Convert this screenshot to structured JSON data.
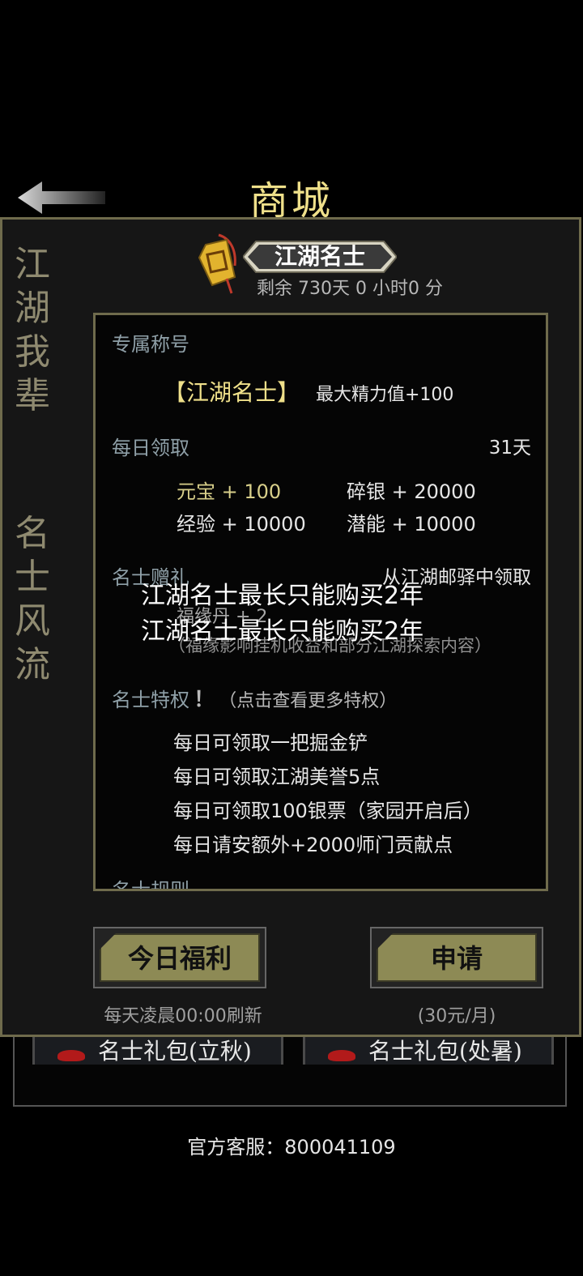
{
  "header": {
    "title": "商城"
  },
  "side_banner": {
    "left_top": [
      "江",
      "湖",
      "我",
      "辈"
    ],
    "left_bottom": [
      "名",
      "士",
      "风",
      "流"
    ]
  },
  "membership": {
    "name": "江湖名士",
    "remaining": "剩余 730天 0 小时0 分"
  },
  "sections": {
    "title_label": "专属称号",
    "title_value": "【江湖名士】",
    "title_bonus": "最大精力值+100",
    "daily_label": "每日领取",
    "daily_days": "31天",
    "daily_items": {
      "yuanbao": "元宝 + 100",
      "suiyin": "碎银 + 20000",
      "jingyan": "经验 + 10000",
      "qianneng": "潜能 + 10000"
    },
    "gift_label": "名士赠礼",
    "gift_source": "从江湖邮驿中领取",
    "gift_item": "福缘丹 + 2",
    "gift_note": "（福缘影响挂机收益和部分江湖探索内容）",
    "privilege_label": "名士特权",
    "privilege_mark": "！",
    "privilege_hint": "（点击查看更多特权）",
    "privileges": [
      "每日可领取一把掘金铲",
      "每日可领取江湖美誉5点",
      "每日可领取100银票（家园开启后）",
      "每日请安额外+2000师门贡献点"
    ],
    "rules_label": "名士规则"
  },
  "toast": [
    "江湖名士最长只能购买2年",
    "江湖名士最长只能购买2年"
  ],
  "buttons": {
    "daily_welfare": "今日福利",
    "daily_refresh": "每天凌晨00:00刷新",
    "apply": "申请",
    "price": "(30元/月)"
  },
  "shop": {
    "gifts": [
      "名士礼包(立秋)",
      "名士礼包(处暑)"
    ],
    "service": "官方客服：800041109"
  },
  "colors": {
    "gold_title": "#efe08a",
    "frame": "#6f6b4c",
    "button": "#8d8a55",
    "yuanbao": "#d8cf8a"
  }
}
